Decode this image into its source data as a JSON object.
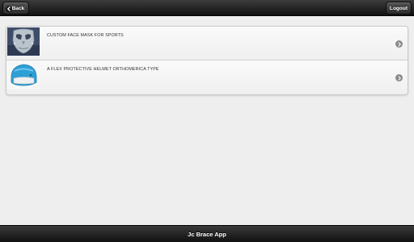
{
  "header": {
    "back_label": "Back",
    "logout_label": "Logout",
    "back_icon": "arrow-left-icon"
  },
  "list": {
    "items": [
      {
        "label": "CUSTOM FACE MASK FOR SPORTS",
        "thumb_icon": "face-mask-image",
        "chevron_icon": "chevron-right-icon"
      },
      {
        "label": "A FLEX PROTECTIVE HELMET ORTHOMERICA TYPE",
        "thumb_icon": "helmet-image",
        "chevron_icon": "chevron-right-icon"
      }
    ]
  },
  "footer": {
    "title": "Jc Brace App"
  },
  "colors": {
    "bar": "#1e1e1e",
    "background": "#eeeeee",
    "helmet": "#2ea0d6"
  }
}
